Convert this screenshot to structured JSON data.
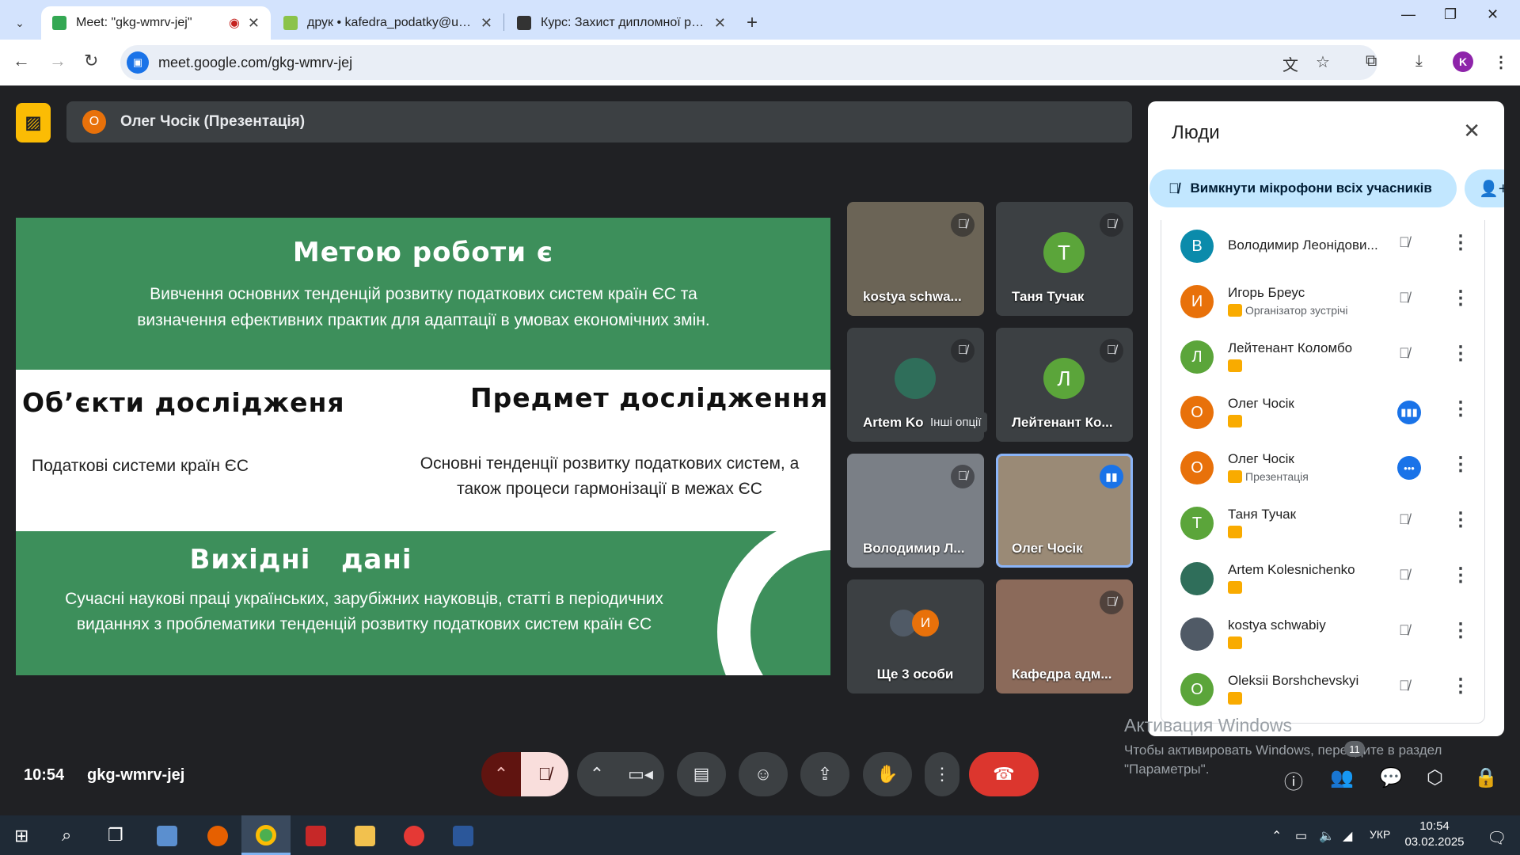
{
  "browser": {
    "tabs": [
      {
        "title": "Meet: \"gkg-wmrv-jej\"",
        "active": true
      },
      {
        "title": "друк • kafedra_podatky@ukr.n",
        "active": false
      },
      {
        "title": "Курс: Захист дипломної робот",
        "active": false
      }
    ],
    "url": "meet.google.com/gkg-wmrv-jej",
    "profile_initial": "K"
  },
  "presenter_bar": {
    "initial": "О",
    "name": "Олег Чосік (Презентація)"
  },
  "slide": {
    "title": "Метою роботи є",
    "goal_text": "Вивчення основних тенденцій розвитку податкових систем країн ЄС та визначення ефективних практик для адаптації в умовах економічних змін.",
    "objects_title": "Об’єкти дослідженя",
    "objects_text": "Податкові системи країн ЄС",
    "subject_title": "Предмет дослідження",
    "subject_text": "Основні тенденції розвитку податкових систем, а також процеси гармонізації в межах ЄС",
    "sources_title": "Вихідні   дані",
    "sources_text": "Сучасні наукові праці українських, зарубіжних науковців, статті в періодичних виданнях з проблематики тенденцій розвитку податкових систем країн ЄС"
  },
  "tiles": [
    {
      "name": "kostya schwa...",
      "initial": "",
      "muted": true
    },
    {
      "name": "Таня Тучак",
      "initial": "Т",
      "muted": true
    },
    {
      "name": "Artem Ko",
      "initial": "",
      "muted": true
    },
    {
      "name": "Лейтенант Ко...",
      "initial": "Л",
      "muted": true
    },
    {
      "name": "Володимир Л...",
      "initial": "",
      "muted": true
    },
    {
      "name": "Олег Чосік",
      "initial": "",
      "muted": false
    },
    {
      "name": "Ще 3 особи",
      "initial": "И",
      "muted": false
    },
    {
      "name": "Кафедра адм...",
      "initial": "",
      "muted": true
    }
  ],
  "tooltip": "Інші опції",
  "footer": {
    "time": "10:54",
    "meeting_code": "gkg-wmrv-jej",
    "participants_badge": "11"
  },
  "people_panel": {
    "title": "Люди",
    "mute_all_label": "Вимкнути мікрофони всіх учасників",
    "people": [
      {
        "initial": "В",
        "name": "Володимир Леонідови...",
        "sub": "",
        "color": "#0b8bab",
        "state": "muted"
      },
      {
        "initial": "И",
        "name": "Игорь Бреус",
        "sub": "Організатор зустрічі",
        "color": "#e8710a",
        "state": "muted"
      },
      {
        "initial": "Л",
        "name": "Лейтенант Коломбо",
        "sub": "",
        "color": "#5ba53a",
        "state": "muted"
      },
      {
        "initial": "О",
        "name": "Олег Чосік",
        "sub": "",
        "color": "#e8710a",
        "state": "speaking"
      },
      {
        "initial": "О",
        "name": "Олег Чосік",
        "sub": "Презентація",
        "color": "#e8710a",
        "state": "more"
      },
      {
        "initial": "Т",
        "name": "Таня Тучак",
        "sub": "",
        "color": "#5ba53a",
        "state": "muted"
      },
      {
        "initial": "",
        "name": "Artem Kolesnichenko",
        "sub": "",
        "color": "#2f6e5a",
        "state": "muted"
      },
      {
        "initial": "",
        "name": "kostya schwabiy",
        "sub": "",
        "color": "#505a66",
        "state": "muted"
      },
      {
        "initial": "О",
        "name": "Oleksii Borshchevskyi",
        "sub": "",
        "color": "#5ba53a",
        "state": "muted"
      }
    ]
  },
  "windows_activation": {
    "title": "Активация Windows",
    "text": "Чтобы активировать Windows, перейдите в раздел \"Параметры\"."
  },
  "taskbar": {
    "lang": "УКР",
    "clock_time": "10:54",
    "clock_date": "03.02.2025"
  }
}
